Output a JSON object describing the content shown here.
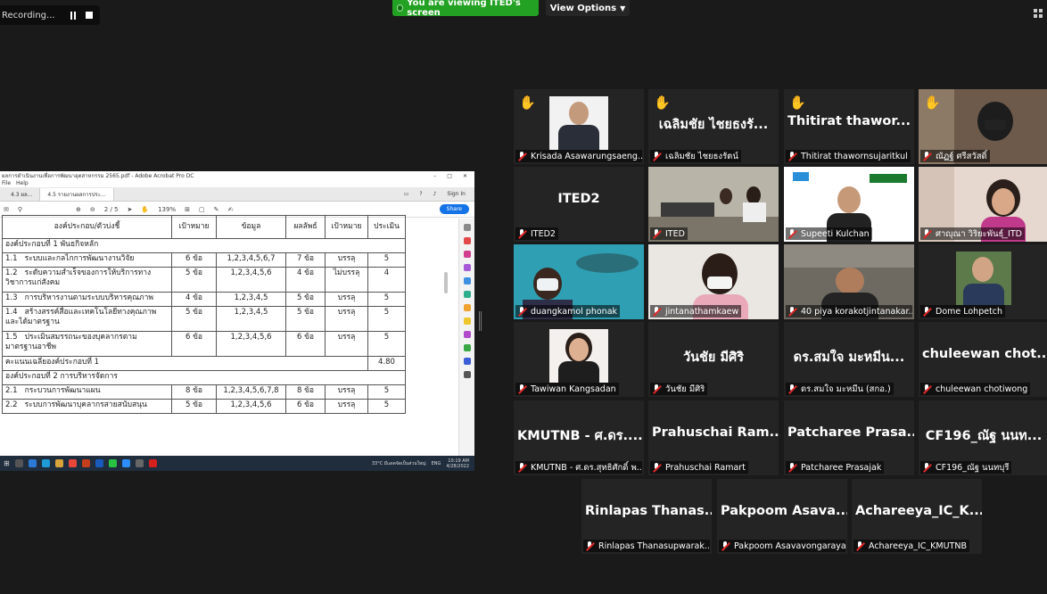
{
  "recording": {
    "label": "Recording..."
  },
  "banner": {
    "text": "You are viewing ITED's screen"
  },
  "view_options": {
    "label": "View Options"
  },
  "colors": {
    "share_green": "#23a123",
    "active_speaker": "#d4c84a",
    "hand": "#f4c11c",
    "mic_off": "#e02828"
  },
  "shared_screen": {
    "window_title": "ผลการดำเนินงานเพื่อการพัฒนาอุตสาหกรรม 2565.pdf - Adobe Acrobat Pro DC",
    "menu": [
      "File",
      "Help"
    ],
    "tabs": [
      "4.3 ผล...",
      "4.5 รายงานผลการประ..."
    ],
    "sign_in": "Sign In",
    "page": "2 / 5",
    "zoom": "139%",
    "share": "Share",
    "table": {
      "header": [
        "องค์ประกอบ/ตัวบ่งชี้",
        "เป้าหมาย",
        "ข้อมูล",
        "ผลลัพธ์",
        "เป้าหมาย",
        "ประเมิน"
      ],
      "rows": [
        {
          "type": "section",
          "text": "องค์ประกอบที่ 1 พันธกิจหลัก"
        },
        {
          "no": "1.1",
          "name": "ระบบและกลไกการพัฒนางานวิจัย",
          "target": "6 ข้อ",
          "data": "1,2,3,4,5,6,7",
          "result": "7 ข้อ",
          "met": "บรรลุ",
          "score": "5"
        },
        {
          "no": "1.2",
          "name": "ระดับความสำเร็จของการให้บริการทางวิชาการแก่สังคม",
          "target": "5 ข้อ",
          "data": "1,2,3,4,5,6",
          "result": "4 ข้อ",
          "met": "ไม่บรรลุ",
          "score": "4"
        },
        {
          "no": "1.3",
          "name": "การบริหารงานตามระบบบริหารคุณภาพ",
          "target": "4 ข้อ",
          "data": "1,2,3,4,5",
          "result": "5 ข้อ",
          "met": "บรรลุ",
          "score": "5"
        },
        {
          "no": "1.4",
          "name": "สร้างสรรค์สื่อและเทคโนโลยีทางคุณภาพและได้มาตรฐาน",
          "target": "5 ข้อ",
          "data": "1,2,3,4,5",
          "result": "5 ข้อ",
          "met": "บรรลุ",
          "score": "5"
        },
        {
          "no": "1.5",
          "name": "ประเมินสมรรถนะของบุคลากรตามมาตรฐานอาชีพ",
          "target": "6 ข้อ",
          "data": "1,2,3,4,5,6",
          "result": "6 ข้อ",
          "met": "บรรลุ",
          "score": "5"
        },
        {
          "type": "avg",
          "text": "คะแนนเฉลี่ยองค์ประกอบที่ 1",
          "score": "4.80"
        },
        {
          "type": "section",
          "text": "องค์ประกอบที่ 2 การบริหารจัดการ"
        },
        {
          "no": "2.1",
          "name": "กระบวนการพัฒนาแผน",
          "target": "8 ข้อ",
          "data": "1,2,3,4,5,6,7,8",
          "result": "8 ข้อ",
          "met": "บรรลุ",
          "score": "5"
        },
        {
          "no": "2.2",
          "name": "ระบบการพัฒนาบุคลากรสายสนับสนุน",
          "target": "5 ข้อ",
          "data": "1,2,3,4,5,6",
          "result": "6 ข้อ",
          "met": "บรรลุ",
          "score": "5"
        }
      ]
    },
    "taskbar": {
      "weather": "33°C มีแดดจัดเป็นส่วนใหญ่",
      "lang": "ENG",
      "time": "10:19 AM",
      "date": "4/28/2022"
    }
  },
  "participants": [
    {
      "name": "Krisada Asawarungsaeng...",
      "big": "",
      "hand": true,
      "photo": "man-suit"
    },
    {
      "name": "เฉลิมชัย ไชยธงรัตน์",
      "big": "เฉลิมชัย ไชยธงรั...",
      "hand": true
    },
    {
      "name": "Thitirat thawornsujaritkul",
      "big": "Thitirat thawor...",
      "hand": true
    },
    {
      "name": "ณัฏฐ์ ศรีสวัสดิ์",
      "big": "",
      "hand": true,
      "photo": "woman-mask"
    },
    {
      "name": "ITED2",
      "big": "ITED2",
      "hand": false
    },
    {
      "name": "ITED",
      "big": "",
      "hand": false,
      "photo": "room",
      "active": true
    },
    {
      "name": "Supeeti Kulchan",
      "big": "",
      "hand": false,
      "photo": "kmutnb-man"
    },
    {
      "name": "ศาญุณา วิริยะพันธุ์_ITD",
      "big": "",
      "hand": false,
      "photo": "woman-glasses"
    },
    {
      "name": "duangkamol phonak",
      "big": "",
      "hand": false,
      "photo": "underwater"
    },
    {
      "name": "jintanathamkaew",
      "big": "",
      "hand": false,
      "photo": "woman-mask2"
    },
    {
      "name": "40 piya korakotjintanakar...",
      "big": "",
      "hand": false,
      "photo": "man-office"
    },
    {
      "name": "Dome Lohpetch",
      "big": "",
      "hand": false,
      "photo": "man-portrait"
    },
    {
      "name": "Tawiwan Kangsadan",
      "big": "",
      "hand": false,
      "photo": "woman-portrait"
    },
    {
      "name": "วันชัย มีศิริ",
      "big": "วันชัย มีศิริ",
      "hand": false
    },
    {
      "name": "ดร.สมใจ มะหมีน (สกอ.)",
      "big": "ดร.สมใจ มะหมีน...",
      "hand": false
    },
    {
      "name": "chuleewan chotiwong",
      "big": "chuleewan chot...",
      "hand": false
    },
    {
      "name": "KMUTNB - ศ.ดร.สุทธิศักดิ์ พ...",
      "big": "KMUTNB - ศ.ดร....",
      "hand": false
    },
    {
      "name": "Prahuschai Ramart",
      "big": "Prahuschai Ram...",
      "hand": false
    },
    {
      "name": "Patcharee Prasajak",
      "big": "Patcharee Prasa...",
      "hand": false
    },
    {
      "name": "CF196_ณัฐ นนทบุรี",
      "big": "CF196_ณัฐ นนท...",
      "hand": false
    },
    {
      "name": "Rinlapas Thanasupwarak...",
      "big": "Rinlapas Thanas...",
      "hand": false
    },
    {
      "name": "Pakpoom Asavavongaraya",
      "big": "Pakpoom Asava...",
      "hand": false
    },
    {
      "name": "Achareeya_IC_KMUTNB",
      "big": "Achareeya_IC_K...",
      "hand": false
    }
  ]
}
